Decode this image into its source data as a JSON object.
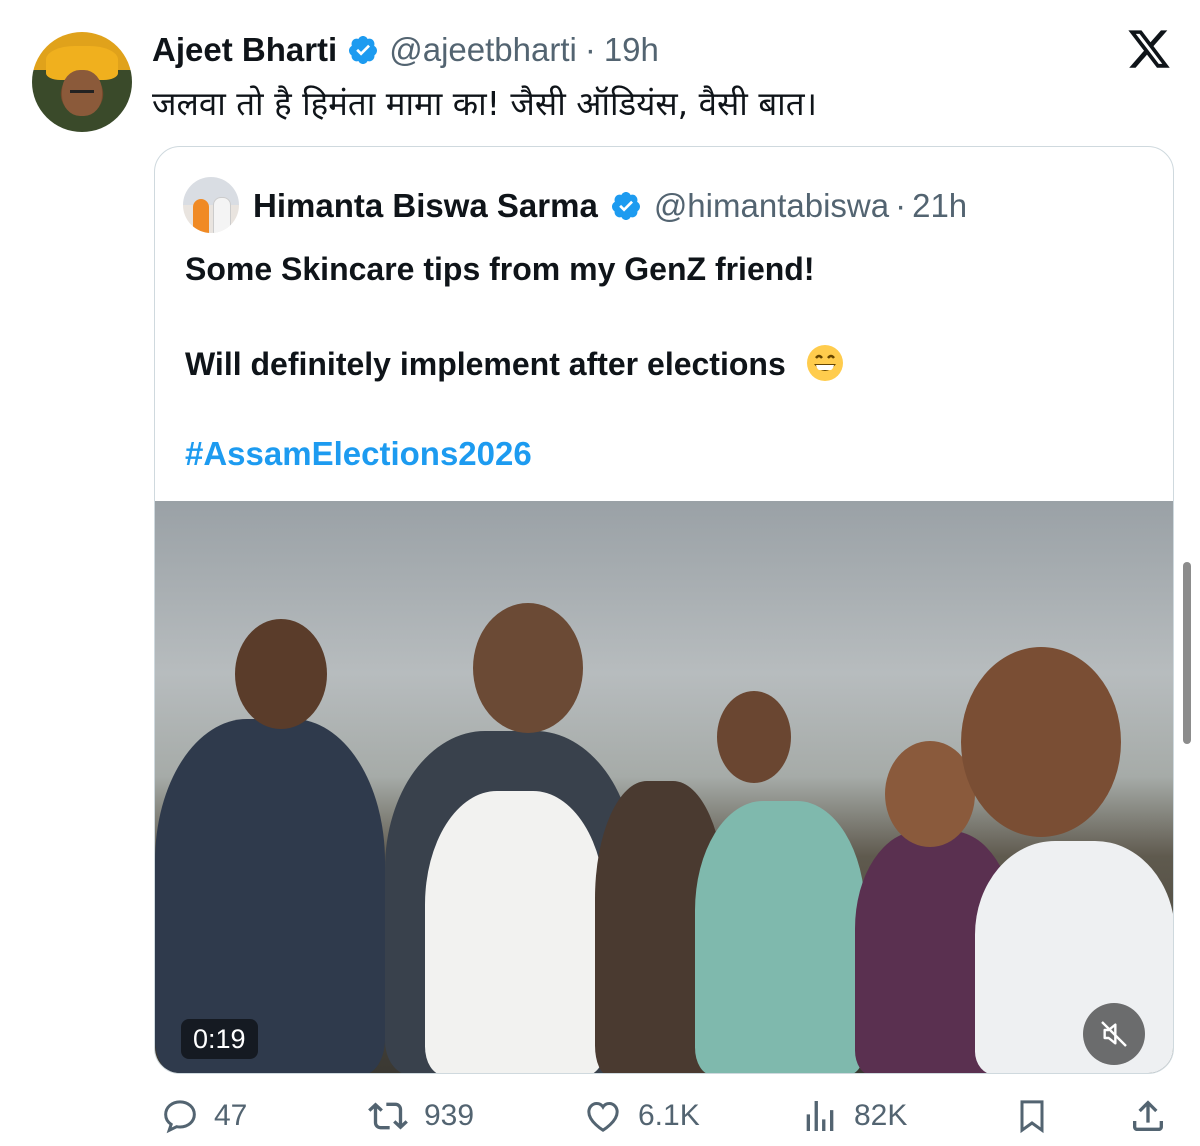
{
  "tweet": {
    "author_name": "Ajeet Bharti",
    "handle": "@ajeetbharti",
    "separator": "·",
    "time": "19h",
    "text": "जलवा तो है हिमंता मामा का! जैसी ऑडियंस, वैसी बात।"
  },
  "quoted_tweet": {
    "author_name": "Himanta Biswa Sarma",
    "handle": "@himantabiswa",
    "separator": "·",
    "time": "21h",
    "line1": "Some Skincare tips from my GenZ friend!",
    "line2": "Will definitely implement after elections",
    "hashtag": "#AssamElections2026",
    "video": {
      "timestamp": "0:19",
      "muted": true
    }
  },
  "actions": {
    "replies": "47",
    "reposts": "939",
    "likes": "6.1K",
    "views": "82K"
  },
  "icons": [
    "verified-badge-icon",
    "x-logo-icon",
    "grinning-emoji-icon",
    "mute-icon",
    "reply-icon",
    "repost-icon",
    "like-icon",
    "views-icon",
    "bookmark-icon",
    "share-icon"
  ],
  "colors": {
    "accent": "#1d9bf0",
    "secondary_text": "#536471",
    "border": "#cfd9de"
  }
}
